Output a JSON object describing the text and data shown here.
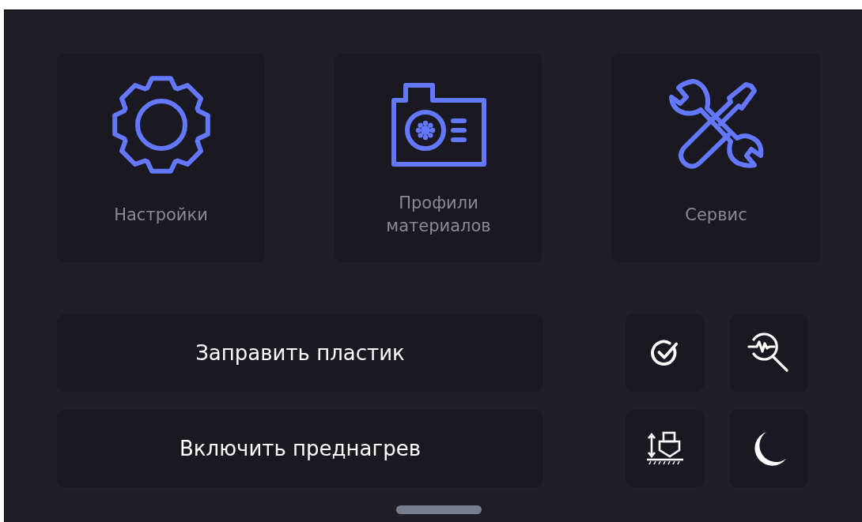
{
  "tiles": [
    {
      "kind": "gear",
      "label": "Настройки"
    },
    {
      "kind": "card",
      "label": "Профили материалов"
    },
    {
      "kind": "tools",
      "label": "Сервис"
    }
  ],
  "actions": [
    {
      "label": "Заправить пластик"
    },
    {
      "label": "Включить преднагрев"
    }
  ],
  "quick_buttons": [
    {
      "kind": "check"
    },
    {
      "kind": "diagnostics"
    },
    {
      "kind": "z-offset"
    },
    {
      "kind": "sleep"
    }
  ]
}
